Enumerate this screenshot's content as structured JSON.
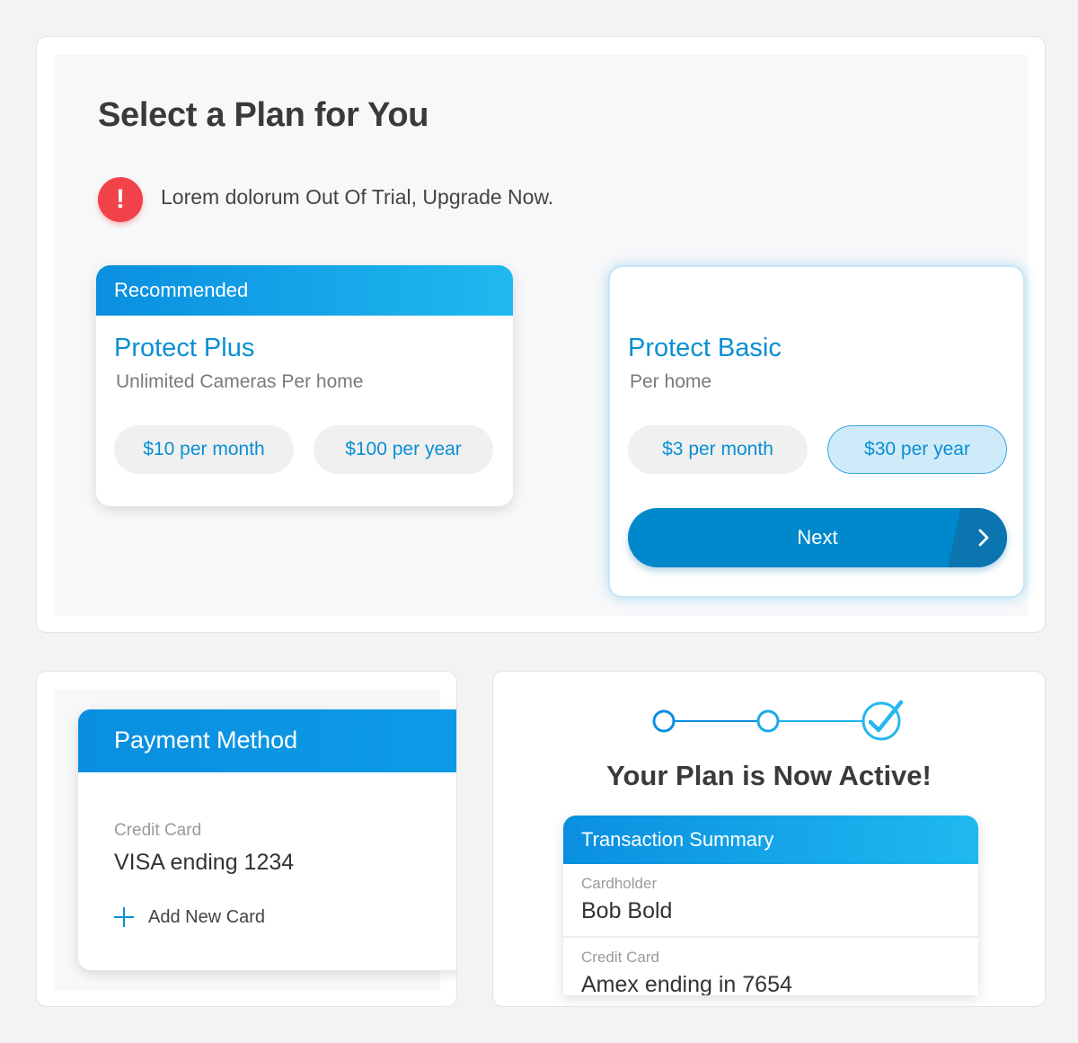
{
  "select_plan": {
    "title": "Select a Plan for You",
    "alert_text": "Lorem dolorum Out Of Trial, Upgrade Now.",
    "plans": [
      {
        "badge": "Recommended",
        "name": "Protect Plus",
        "description": "Unlimited Cameras Per home",
        "monthly_price": "$10 per month",
        "yearly_price": "$100 per year",
        "selected_option": "none"
      },
      {
        "badge": "",
        "name": "Protect Basic",
        "description": "Per home",
        "monthly_price": "$3 per month",
        "yearly_price": "$30 per year",
        "selected_option": "yearly"
      }
    ],
    "next_label": "Next"
  },
  "payment": {
    "title": "Payment Method",
    "card_label": "Credit Card",
    "card_value": "VISA ending 1234",
    "add_card_label": "Add New Card"
  },
  "confirmation": {
    "stepper": {
      "total_steps": 3,
      "completed_step": 3
    },
    "title": "Your Plan is Now Active!",
    "summary": {
      "title": "Transaction Summary",
      "cardholder_label": "Cardholder",
      "cardholder_value": "Bob Bold",
      "credit_card_label": "Credit Card",
      "credit_card_value": "Amex ending in 7654"
    }
  },
  "colors": {
    "brand_blue": "#0a8fe0",
    "accent_blue": "#1fb9ef",
    "button_blue": "#0088cc",
    "alert_red": "#f1424a",
    "check_cyan": "#24b8ee"
  },
  "icons": {
    "alert": "exclamation-circle-icon",
    "next": "chevron-right-icon",
    "add": "plus-icon",
    "step_done": "check-circle-icon"
  }
}
